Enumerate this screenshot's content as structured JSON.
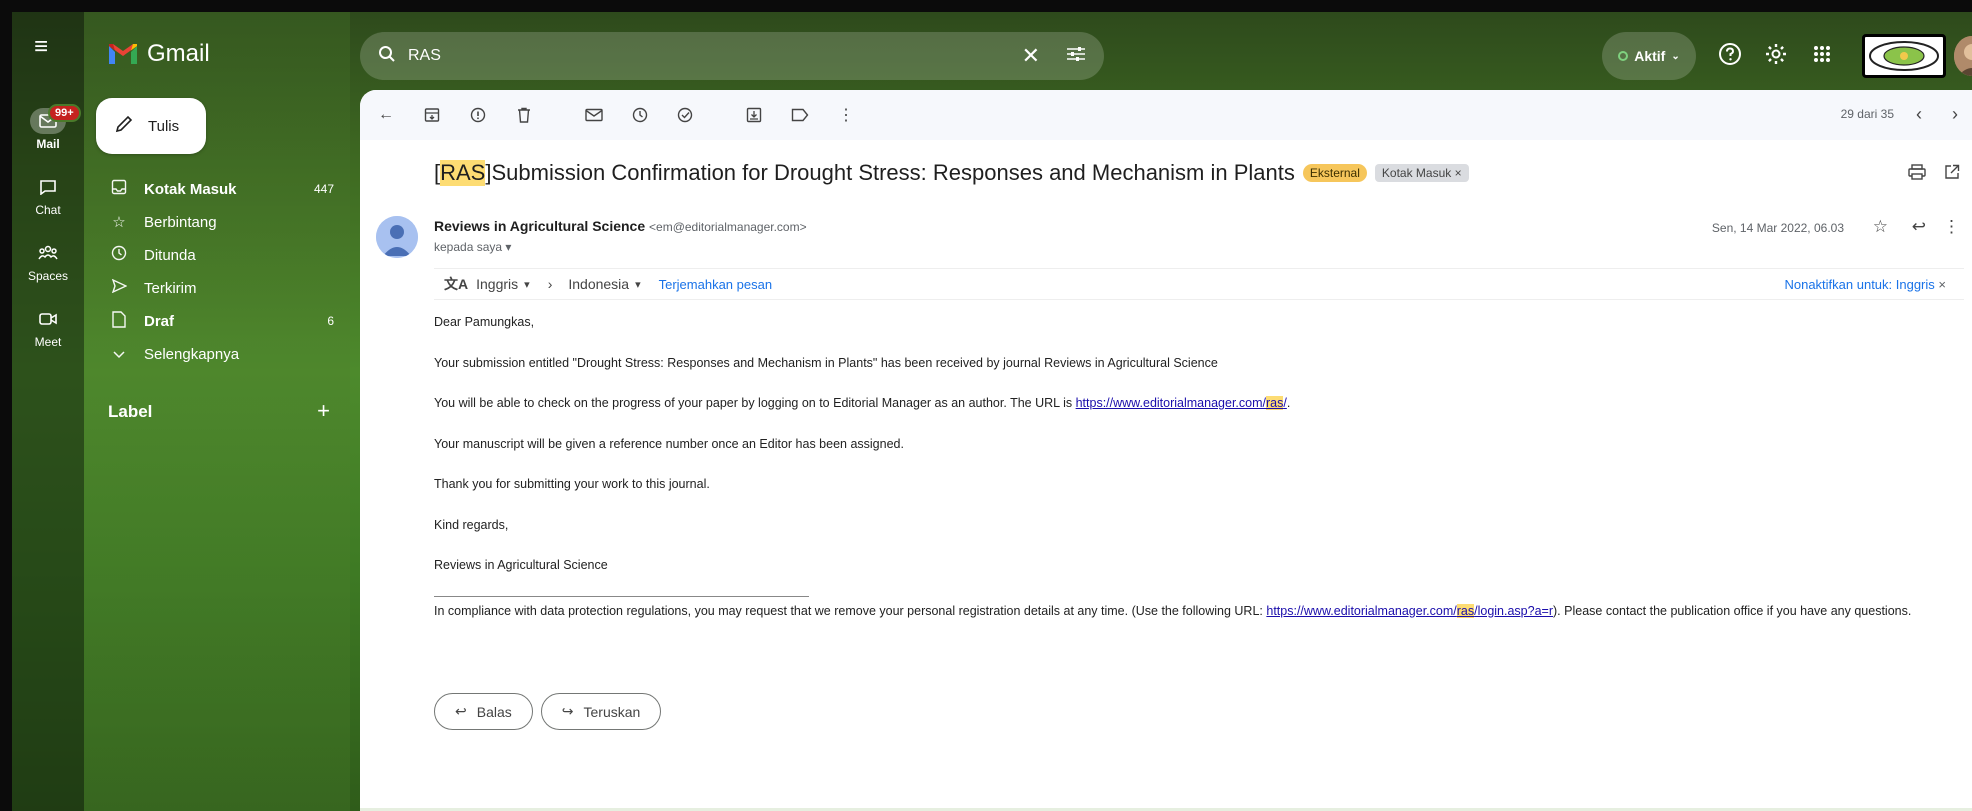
{
  "app": {
    "name": "Gmail"
  },
  "rail": [
    {
      "label": "Mail",
      "badge": "99+",
      "icon": "mail-icon"
    },
    {
      "label": "Chat",
      "icon": "chat-icon"
    },
    {
      "label": "Spaces",
      "icon": "spaces-icon"
    },
    {
      "label": "Meet",
      "icon": "meet-icon"
    }
  ],
  "compose": {
    "label": "Tulis"
  },
  "folders": [
    {
      "label": "Kotak Masuk",
      "count": "447",
      "bold": true,
      "icon": "inbox-icon"
    },
    {
      "label": "Berbintang",
      "count": "",
      "icon": "star-icon"
    },
    {
      "label": "Ditunda",
      "count": "",
      "icon": "clock-icon"
    },
    {
      "label": "Terkirim",
      "count": "",
      "icon": "send-icon"
    },
    {
      "label": "Draf",
      "count": "6",
      "bold": true,
      "icon": "draft-icon"
    },
    {
      "label": "Selengkapnya",
      "count": "",
      "icon": "chevron-down-icon"
    }
  ],
  "labels": {
    "heading": "Label"
  },
  "search": {
    "query": "RAS"
  },
  "status": {
    "label": "Aktif"
  },
  "toolbar": {
    "pager": "29 dari 35"
  },
  "email": {
    "subject_prefix_open": "[",
    "subject_tag": "RAS",
    "subject_prefix_close": "]",
    "subject_rest": " Submission Confirmation for Drought Stress: Responses and Mechanism in Plants",
    "chip_external": "Eksternal",
    "chip_inbox": "Kotak Masuk",
    "sender_name": "Reviews in Agricultural Science",
    "sender_email": "<em@editorialmanager.com>",
    "to": "kepada saya",
    "date": "Sen, 14 Mar 2022, 06.03",
    "translate": {
      "from": "Inggris",
      "to": "Indonesia",
      "action": "Terjemahkan pesan",
      "disable": "Nonaktifkan untuk: Inggris"
    },
    "body": {
      "greeting": "Dear  Pamungkas,",
      "p1": "Your submission entitled \"Drought Stress: Responses and Mechanism in Plants\" has been received by journal Reviews in Agricultural Science",
      "p2_pre": "You will be able to check on the progress of your paper by logging on to Editorial Manager as an author.  The URL is ",
      "p2_link_a": "https://www.editorialmanager.com/",
      "p2_link_hl": "ras",
      "p2_link_b": "/",
      "p2_post": ".",
      "p3": "Your manuscript will be given a reference number once an Editor has been assigned.",
      "p4": "Thank you for submitting your work to this journal.",
      "p5": "Kind regards,",
      "p6": "Reviews in Agricultural Science",
      "p7_pre": "In compliance with data protection regulations, you may request that we remove your personal registration details at any time.  (Use the following URL: ",
      "p7_link_a": "https://www.editorialmanager.com/",
      "p7_link_hl": "ras",
      "p7_link_b": "/login.asp?a=r",
      "p7_post": "). Please contact the publication office if you have any questions."
    },
    "reply_label": "Balas",
    "forward_label": "Teruskan"
  }
}
